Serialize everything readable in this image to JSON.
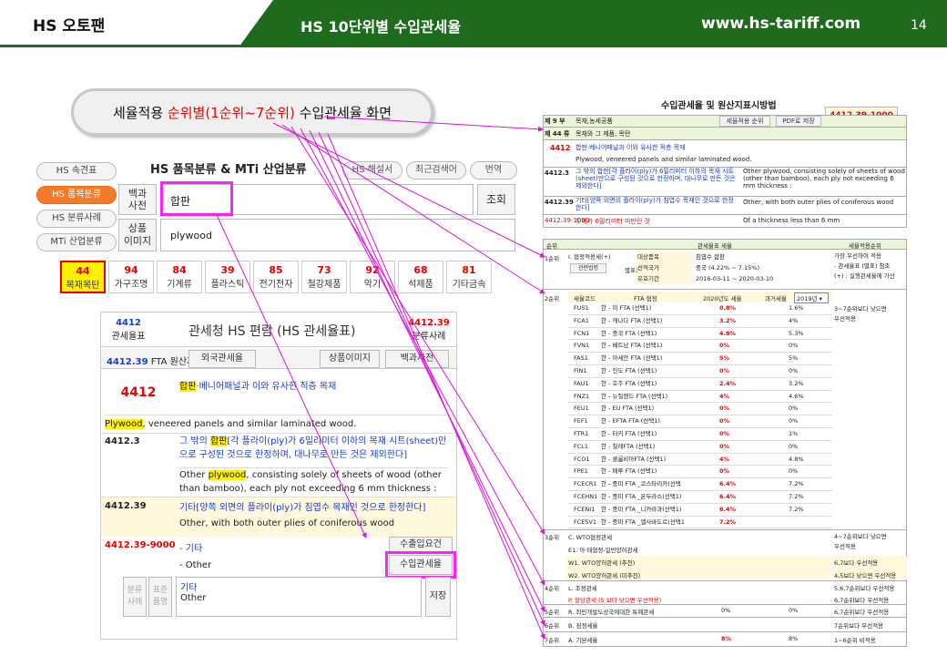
{
  "header": {
    "brand": "HS 오토팬",
    "title": "HS 10단위별 수입관세율",
    "url": "www.hs-tariff.com",
    "page": "14"
  },
  "callout": {
    "pre": "세율적용 ",
    "red": "순위별(1순위~7순위)",
    "post": " 수입관세율 화면"
  },
  "left": {
    "side_buttons": [
      "HS 속견표",
      "HS 품목분류",
      "HS 분류사례",
      "MTi 산업분류"
    ],
    "section_title": "HS 품목분류  &  MTi 산업분류",
    "top_pills": [
      "HS 해설서",
      "최근검색어",
      "번역"
    ],
    "dict_label": "백과\n사전",
    "dict_value": "합판",
    "search_btn": "조회",
    "img_label": "상품\n이미지",
    "img_value": "plywood",
    "categories": [
      {
        "n": "44",
        "l": "목재목탄"
      },
      {
        "n": "94",
        "l": "가구조명"
      },
      {
        "n": "84",
        "l": "기계류"
      },
      {
        "n": "39",
        "l": "플라스틱"
      },
      {
        "n": "85",
        "l": "전기전자"
      },
      {
        "n": "73",
        "l": "철강제품"
      },
      {
        "n": "92",
        "l": "악기"
      },
      {
        "n": "68",
        "l": "석제품"
      },
      {
        "n": "81",
        "l": "기타금속"
      }
    ]
  },
  "book": {
    "tab_left_code": "4412",
    "tab_left_label": "관세율표",
    "title": "관세청 HS 편람 (HS 관세율표)",
    "tab_right_code": "4412.39",
    "tab_right_label": "분류사례",
    "fta_code": "4412.39",
    "fta_label": " FTA 원산지",
    "foreign_btn": "외국관세율",
    "img_btn": "상품이미지",
    "dict_btn": "백과사전",
    "h4412": "4412",
    "h4412_desc_pre": "합판",
    "h4412_desc": "·베니어패널과 이와 유사한 적층 목재",
    "ply_en_hl": "Plywood",
    "ply_en": ", veneered panels and similar laminated wood.",
    "s3_code": "4412.3",
    "s3_ko_pre": "그 밖의 ",
    "s3_ko_hl": "합판",
    "s3_ko": "[각 플라이(ply)가 6밀리미터 이하의 목재 시트(sheet)만으로 구성된 것으로 한정하며, 대나무로 만든 것은 제외한다]",
    "s3_en_pre": "Other ",
    "s3_en_hl": "plywood",
    "s3_en": ", consisting solely of sheets of wood (other than bamboo), each ply not exceeding 6 mm thickness :",
    "s39_code": "4412.39",
    "s39_ko": "기타[양쪽 외면의 플라이(ply)가 침엽수 목재인 것으로 한정한다]",
    "s39_en": "Other, with both outer plies of coniferous wood",
    "s9000_code": "4412.39-9000",
    "s9000_ko": "- 기타",
    "s9000_en": "- Other",
    "export_btn": "수출입요건",
    "import_btn": "수입관세율",
    "side1": "분류\n사례",
    "side2": "표준\n품명",
    "memo1": "기타",
    "memo2": "Other",
    "save_btn": "저장"
  },
  "right": {
    "title": "수입관세율 및 원산지표시방법",
    "code_box": "4412.39-1000",
    "top_rows": [
      {
        "a": "제 9 부",
        "b": "목재,농세공품",
        "btn1": "세율적용 순위",
        "btn2": "PDF로 저장"
      },
      {
        "a": "제 44 류",
        "b": "목재와 그 제품, 목탄"
      }
    ],
    "r4412": {
      "code": "4412",
      "ko": "합판·베니어패널과 이와 유사한 적층 목재",
      "en": "Plywood, veneered panels and similar laminated wood."
    },
    "r3": {
      "code": "4412.3",
      "ko": "그 밖의 합판[각 플라이(ply)가 6밀리미터 이하의 목재 시트(sheet)만으로 구성된 것으로 한정하며, 대나무로 만든 것은 제외한다]",
      "en": "Other plywood, consisting solely of sheets of wood (other than bamboo), each ply not exceeding 6 mm thickness :"
    },
    "r39": {
      "code": "4412.39",
      "ko": "기타[양쪽 외면의 플라이(ply)가 침엽수 목재인 것으로 한정한다]",
      "en": "Other, with both outer plies of coniferous wood"
    },
    "r1000": {
      "code": "4412.39-1000",
      "ko": "두께가 6밀리미터 미만인 것",
      "en": "Of a thickness less than 6 mm"
    },
    "rank_head": [
      "순위",
      "관세율표 세율",
      "세율적용순위"
    ],
    "rank1": {
      "rank": "1순위",
      "label": "I. 협정적용세(+)",
      "btn": "관련법령",
      "annex": "별표1 :",
      "cells": [
        [
          "대상품목",
          "침엽수 합판"
        ],
        [
          "선적국가",
          "중국 (4.22% ~ 7.15%)"
        ],
        [
          "유효기간",
          "2016-03-11 ~ 2020-03-10"
        ]
      ],
      "note": "가장 우선하여 적용\n- 관세율표 (별표) 참조\n(+) : 실행관세율에 가산"
    },
    "rank2": {
      "rank": "2순위",
      "head": [
        "세율코드",
        "FTA 협정",
        "2020년도 세율",
        "과거세율",
        "2019년"
      ],
      "note": "3~7순위보다 낮으면\n우선적용",
      "rows": [
        [
          "FUS1",
          "한 - 미 FTA (선택1)",
          "0.8%",
          "1.6%"
        ],
        [
          "FCA1",
          "한 - 캐나다 FTA (선택1)",
          "3.2%",
          "4%"
        ],
        [
          "FCN1",
          "한 - 중국 FTA (선택1)",
          "4.8%",
          "5.3%"
        ],
        [
          "FVN1",
          "한 - 베트남 FTA (선택1)",
          "0%",
          "0%"
        ],
        [
          "FAS1",
          "한 - 아세안 FTA (선택1)",
          "5%",
          "5%"
        ],
        [
          "FIN1",
          "한 - 인도 FTA (선택1)",
          "0%",
          "0%"
        ],
        [
          "FAU1",
          "한 - 호주 FTA (선택1)",
          "2.4%",
          "3.2%"
        ],
        [
          "FNZ1",
          "한 - 뉴질랜드 FTA (선택1)",
          "4%",
          "4.6%"
        ],
        [
          "FEU1",
          "한 - EU FTA (선택1)",
          "0%",
          "0%"
        ],
        [
          "FEF1",
          "한 - EFTA FTA (선택1)",
          "0%",
          "0%"
        ],
        [
          "FTR1",
          "한 - 터키 FTA (선택1)",
          "0%",
          "1%"
        ],
        [
          "FCL1",
          "한 - 칠레FTA (선택1)",
          "0%",
          "0%"
        ],
        [
          "FCO1",
          "한 - 콜롬비아FTA (선택1)",
          "4%",
          "4.8%"
        ],
        [
          "FPE1",
          "한 - 페루 FTA (선택1)",
          "0%",
          "0%"
        ],
        [
          "FCECR1",
          "한 - 중미 FTA _코스타리카(선택",
          "6.4%",
          "7.2%"
        ],
        [
          "FCEHN1",
          "한 - 중미 FTA _온두라스(선택1)",
          "6.4%",
          "7.2%"
        ],
        [
          "FCENI1",
          "한 - 중미 FTA _니카라과(선택1)",
          "6.4%",
          "7.2%"
        ],
        [
          "FCESV1",
          "한 - 중미 FTA _엘사바도르(선택1",
          "7.2%",
          ""
        ]
      ]
    },
    "rank3": {
      "rank": "3순위",
      "lines": [
        "C. WTO협정관세",
        "E1. 아·태협정-일반양허관세",
        "W1. WTO양허관세 (추천)",
        "W2. WTO양허관세 (미추천)"
      ],
      "notes": [
        "4~7순위보다 낮으면\n우선적용",
        "",
        "6,7보다 우선적용",
        "4,5보다 낮으면 우선적용"
      ]
    },
    "rank4": {
      "rank": "4순위",
      "lines": [
        "L. 조정관세",
        "P. 할당관세 (5 보다 낮으면 우선적용)"
      ],
      "notes": [
        "5,6,7순위보다 우선적용",
        "6,7순위보다 우선적용"
      ]
    },
    "rank5": {
      "rank": "5순위",
      "line": "R. 최빈개발도상국에대한 특혜관세",
      "v1": "0%",
      "v2": "0%",
      "note": "6,7순위보다 우선적용"
    },
    "rank6": {
      "rank": "6순위",
      "line": "B. 잠정세율",
      "note": "7순위보다 우선적용"
    },
    "rank7": {
      "rank": "7순위",
      "line": "A. 기본세율",
      "v1": "8%",
      "v2": "8%",
      "note": "1~6순위 비적용"
    }
  }
}
